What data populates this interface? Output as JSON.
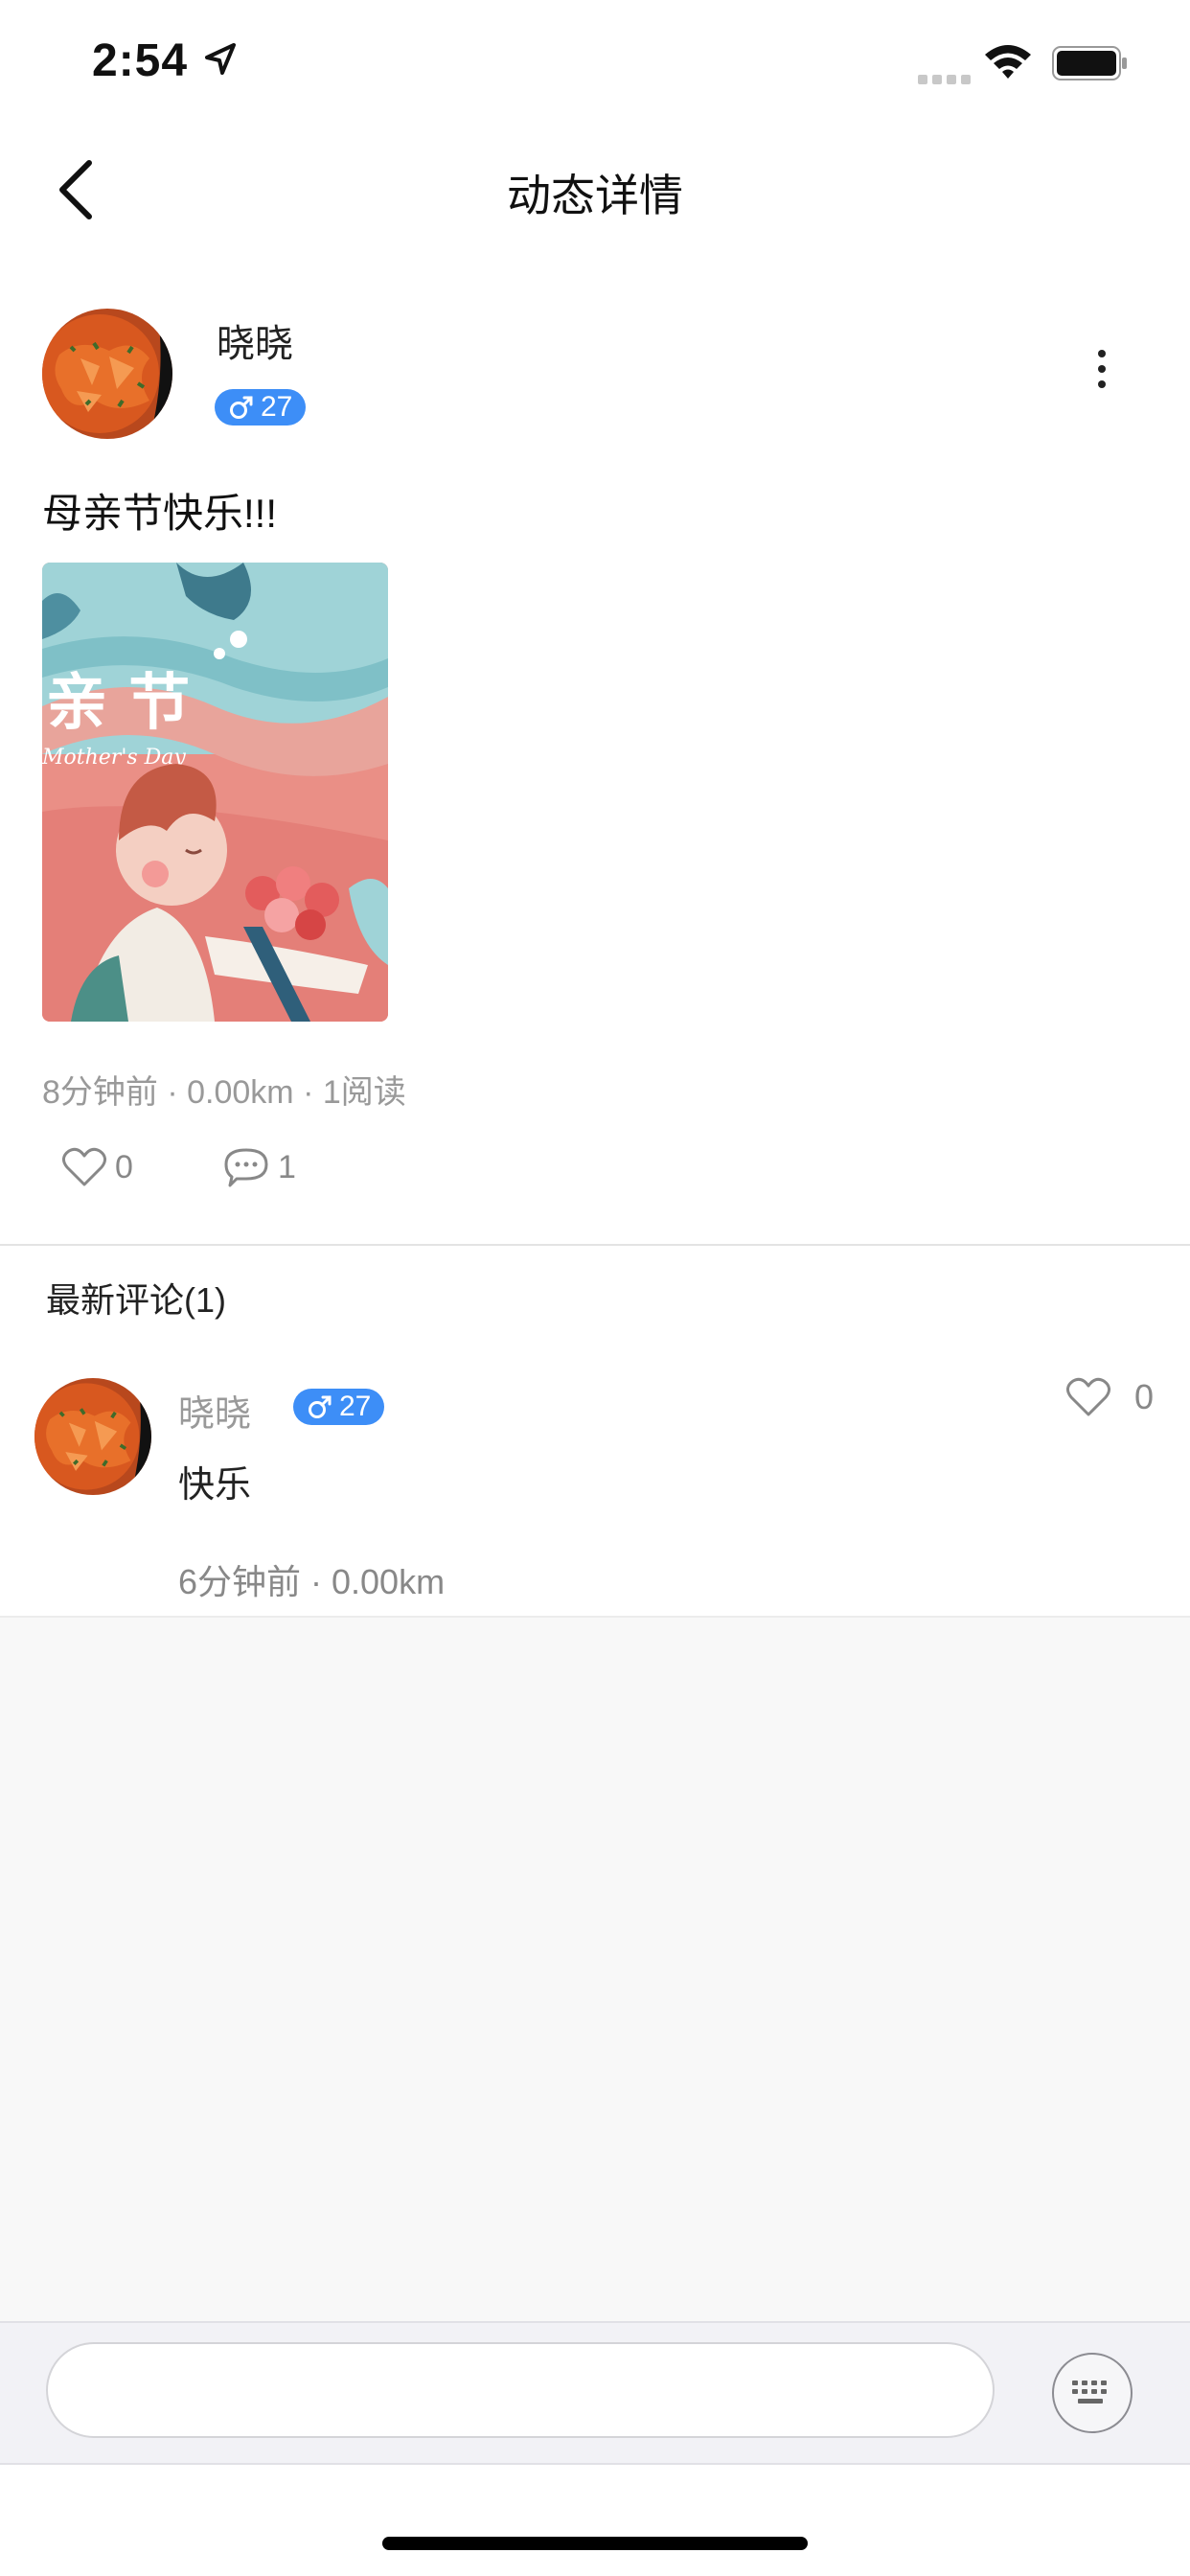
{
  "status_bar": {
    "time": "2:54",
    "icons": [
      "location-arrow-icon",
      "signal-dots-icon",
      "wifi-icon",
      "battery-icon"
    ]
  },
  "nav": {
    "title": "动态详情",
    "back_icon": "chevron-left-icon",
    "more_icon": "more-vertical-icon"
  },
  "post": {
    "username": "晓晓",
    "badge": {
      "gender_icon": "male-icon",
      "age": "27"
    },
    "text": "母亲节快乐!!!",
    "image_text": {
      "title": "亲 节",
      "subtitle": "Mother's Day"
    },
    "meta": "8分钟前 · 0.00km · 1阅读",
    "likes": "0",
    "comments": "1"
  },
  "comments_section": {
    "title": "最新评论(1)",
    "items": [
      {
        "username": "晓晓",
        "badge_age": "27",
        "text": "快乐",
        "meta": "6分钟前 · 0.00km",
        "likes": "0"
      }
    ]
  },
  "input": {
    "placeholder": "",
    "keyboard_icon": "keyboard-icon"
  },
  "colors": {
    "badge": "#3d8ef7",
    "meta_text": "#999999",
    "empty_bg": "#f8f8f8",
    "input_bar_bg": "#f2f2f6"
  }
}
